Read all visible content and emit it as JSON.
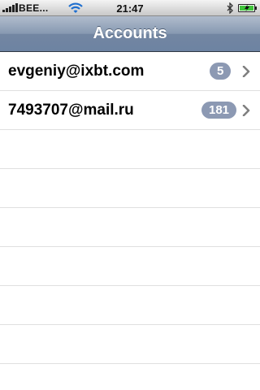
{
  "status_bar": {
    "carrier": "BEE...",
    "time": "21:47"
  },
  "nav": {
    "title": "Accounts"
  },
  "accounts": [
    {
      "email": "evgeniy@ixbt.com",
      "unread": "5"
    },
    {
      "email": "7493707@mail.ru",
      "unread": "181"
    }
  ],
  "icons": {
    "signal": "signal-icon",
    "wifi": "wifi-icon",
    "bluetooth": "bluetooth-icon",
    "battery": "battery-charging-icon",
    "disclosure": "chevron-right-icon"
  },
  "colors": {
    "nav_bar": "#7386a2",
    "badge": "#8c99b3",
    "battery_fill": "#3fc43a"
  }
}
